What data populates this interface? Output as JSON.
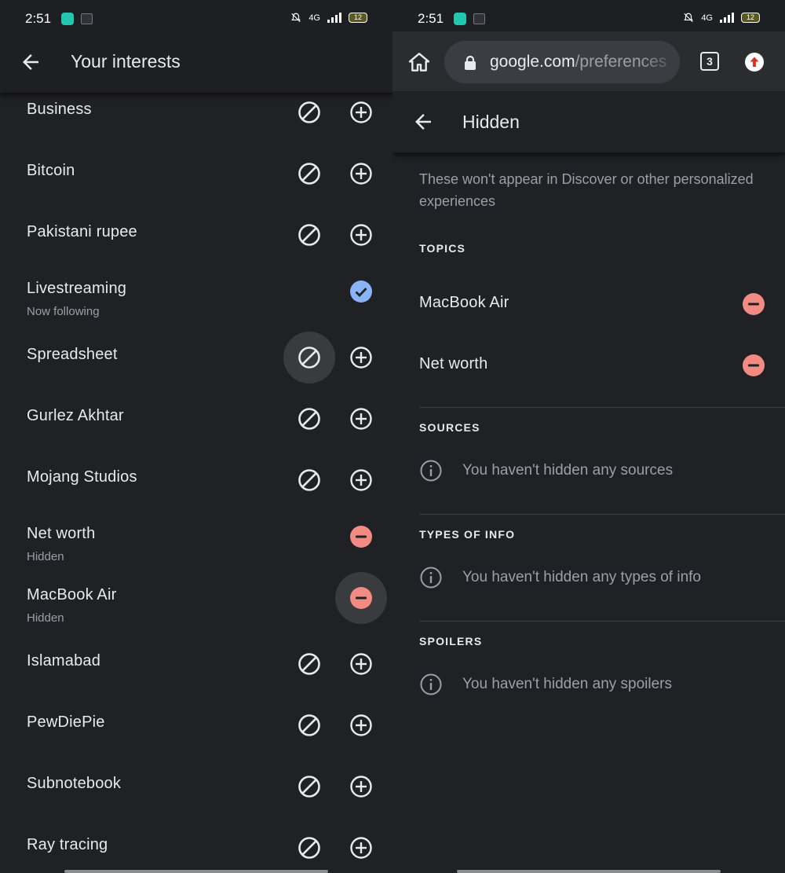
{
  "status_bar": {
    "time": "2:51",
    "network": "4G",
    "battery": "12"
  },
  "left": {
    "title": "Your interests",
    "interests": [
      {
        "label": "Business",
        "sub": "",
        "state": "default"
      },
      {
        "label": "Bitcoin",
        "sub": "",
        "state": "default"
      },
      {
        "label": "Pakistani rupee",
        "sub": "",
        "state": "default"
      },
      {
        "label": "Livestreaming",
        "sub": "Now following",
        "state": "following"
      },
      {
        "label": "Spreadsheet",
        "sub": "",
        "state": "default",
        "pressed": "block"
      },
      {
        "label": "Gurlez Akhtar",
        "sub": "",
        "state": "default"
      },
      {
        "label": "Mojang Studios",
        "sub": "",
        "state": "default"
      },
      {
        "label": "Net worth",
        "sub": "Hidden",
        "state": "hidden"
      },
      {
        "label": "MacBook Air",
        "sub": "Hidden",
        "state": "hidden",
        "pressed": "remove"
      },
      {
        "label": "Islamabad",
        "sub": "",
        "state": "default"
      },
      {
        "label": "PewDiePie",
        "sub": "",
        "state": "default"
      },
      {
        "label": "Subnotebook",
        "sub": "",
        "state": "default"
      },
      {
        "label": "Ray tracing",
        "sub": "",
        "state": "default"
      }
    ]
  },
  "right": {
    "url_host": "google.com",
    "url_path": "/preferences",
    "tab_count": "3",
    "title": "Hidden",
    "description": "These won't appear in Discover or other personalized experiences",
    "topics": {
      "heading": "TOPICS",
      "items": [
        "MacBook Air",
        "Net worth"
      ]
    },
    "sources": {
      "heading": "SOURCES",
      "empty": "You haven't hidden any sources"
    },
    "types": {
      "heading": "TYPES OF INFO",
      "empty": "You haven't hidden any types of info"
    },
    "spoilers": {
      "heading": "SPOILERS",
      "empty": "You haven't hidden any spoilers"
    }
  },
  "colors": {
    "background": "#202124",
    "text": "#e8eaed",
    "secondary": "#9aa0a6",
    "follow": "#8ab4f8",
    "hidden": "#f28b82"
  },
  "icons": {
    "back": "arrow-back-icon",
    "block": "block-icon",
    "add": "add-circle-icon",
    "following": "check-circle-icon",
    "hidden": "remove-circle-icon",
    "home": "home-icon",
    "lock": "lock-icon",
    "info": "info-icon",
    "update": "update-icon"
  }
}
